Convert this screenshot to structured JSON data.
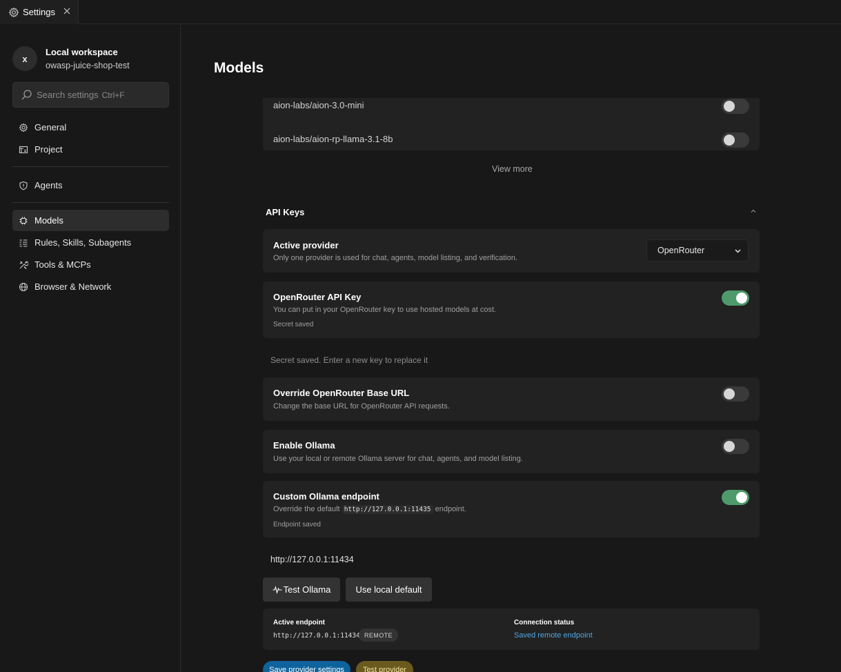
{
  "tab": {
    "label": "Settings"
  },
  "workspace": {
    "initial": "x",
    "name": "Local workspace",
    "project": "owasp-juice-shop-test"
  },
  "search": {
    "placeholder": "Search settings",
    "shortcut": "Ctrl+F"
  },
  "nav": {
    "general": "General",
    "project": "Project",
    "agents": "Agents",
    "models": "Models",
    "rules": "Rules, Skills, Subagents",
    "tools": "Tools & MCPs",
    "browser": "Browser & Network"
  },
  "page": {
    "title": "Models"
  },
  "models_list": {
    "items": [
      {
        "name": "aion-labs/aion-3.0-mini",
        "enabled": false
      },
      {
        "name": "aion-labs/aion-rp-llama-3.1-8b",
        "enabled": false
      }
    ],
    "view_more": "View more"
  },
  "api_keys": {
    "title": "API Keys",
    "active_provider": {
      "title": "Active provider",
      "desc": "Only one provider is used for chat, agents, model listing, and verification.",
      "selected": "OpenRouter"
    },
    "openrouter_key": {
      "title": "OpenRouter API Key",
      "desc": "You can put in your OpenRouter key to use hosted models at cost.",
      "status": "Secret saved",
      "enabled": true,
      "hint": "Secret saved. Enter a new key to replace it"
    },
    "override_base_url": {
      "title": "Override OpenRouter Base URL",
      "desc": "Change the base URL for OpenRouter API requests.",
      "enabled": false
    },
    "enable_ollama": {
      "title": "Enable Ollama",
      "desc": "Use your local or remote Ollama server for chat, agents, and model listing.",
      "enabled": false
    },
    "custom_endpoint": {
      "title": "Custom Ollama endpoint",
      "desc_prefix": "Override the default",
      "desc_code": "http://127.0.0.1:11435",
      "desc_suffix": "endpoint.",
      "status": "Endpoint saved",
      "enabled": true,
      "value": "http://127.0.0.1:11434"
    },
    "buttons": {
      "test_ollama": "Test Ollama",
      "use_local_default": "Use local default"
    },
    "status": {
      "endpoint_label": "Active endpoint",
      "endpoint_value": "http://127.0.0.1:11434",
      "endpoint_badge": "REMOTE",
      "connection_label": "Connection status",
      "connection_value": "Saved remote endpoint"
    },
    "footer": {
      "save_label": "Save provider settings",
      "test_label": "Test provider",
      "save_color": "#0e639c",
      "test_color": "#6b5a1e"
    }
  },
  "colors": {
    "toggle_on": "#4e9a6b",
    "link": "#4fa6e0",
    "background": "#181818",
    "card": "#222222"
  }
}
